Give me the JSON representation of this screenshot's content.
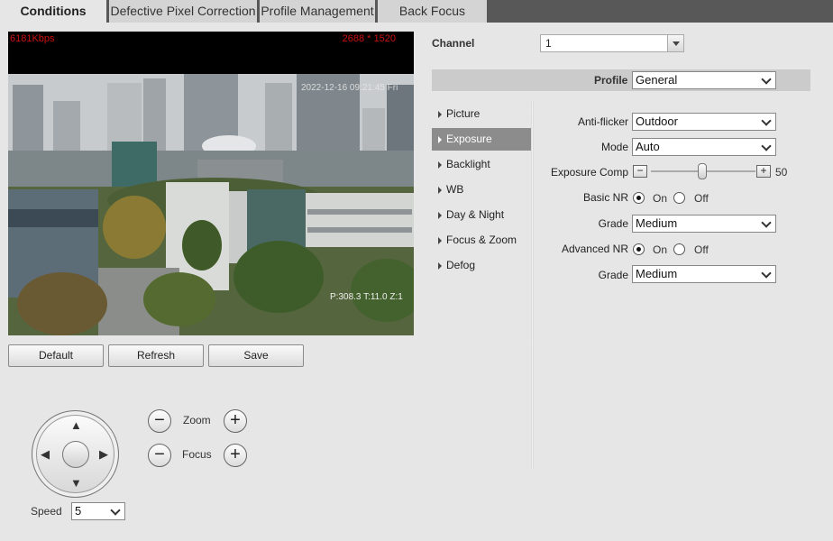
{
  "tabs": [
    {
      "label": "Conditions",
      "active": true
    },
    {
      "label": "Defective Pixel Correction",
      "active": false
    },
    {
      "label": "Profile Management",
      "active": false
    },
    {
      "label": "Back Focus",
      "active": false
    }
  ],
  "video": {
    "bitrate": "6181Kbps",
    "resolution": "2688 * 1520",
    "timestamp": "2022-12-16 09:21:45 Fri",
    "ptz_readout": "P:308.3 T:11.0 Z:1"
  },
  "buttons": {
    "default": "Default",
    "refresh": "Refresh",
    "save": "Save"
  },
  "ptz": {
    "zoom_label": "Zoom",
    "focus_label": "Focus",
    "speed_label": "Speed",
    "speed_value": "5"
  },
  "channel": {
    "label": "Channel",
    "value": "1"
  },
  "profile": {
    "label": "Profile",
    "value": "General"
  },
  "menu": [
    {
      "label": "Picture",
      "active": false
    },
    {
      "label": "Exposure",
      "active": true
    },
    {
      "label": "Backlight",
      "active": false
    },
    {
      "label": "WB",
      "active": false
    },
    {
      "label": "Day & Night",
      "active": false
    },
    {
      "label": "Focus & Zoom",
      "active": false
    },
    {
      "label": "Defog",
      "active": false
    }
  ],
  "exposure": {
    "anti_flicker_label": "Anti-flicker",
    "anti_flicker_value": "Outdoor",
    "mode_label": "Mode",
    "mode_value": "Auto",
    "comp_label": "Exposure Comp",
    "comp_value": "50",
    "basic_nr_label": "Basic NR",
    "on_label": "On",
    "off_label": "Off",
    "basic_nr": "On",
    "grade_label": "Grade",
    "grade1_value": "Medium",
    "advanced_nr_label": "Advanced NR",
    "advanced_nr": "On",
    "grade2_value": "Medium"
  },
  "colors": {
    "tab_bar": "#585858",
    "osd_red": "#cc1111",
    "menu_active": "#8c8c8c"
  }
}
